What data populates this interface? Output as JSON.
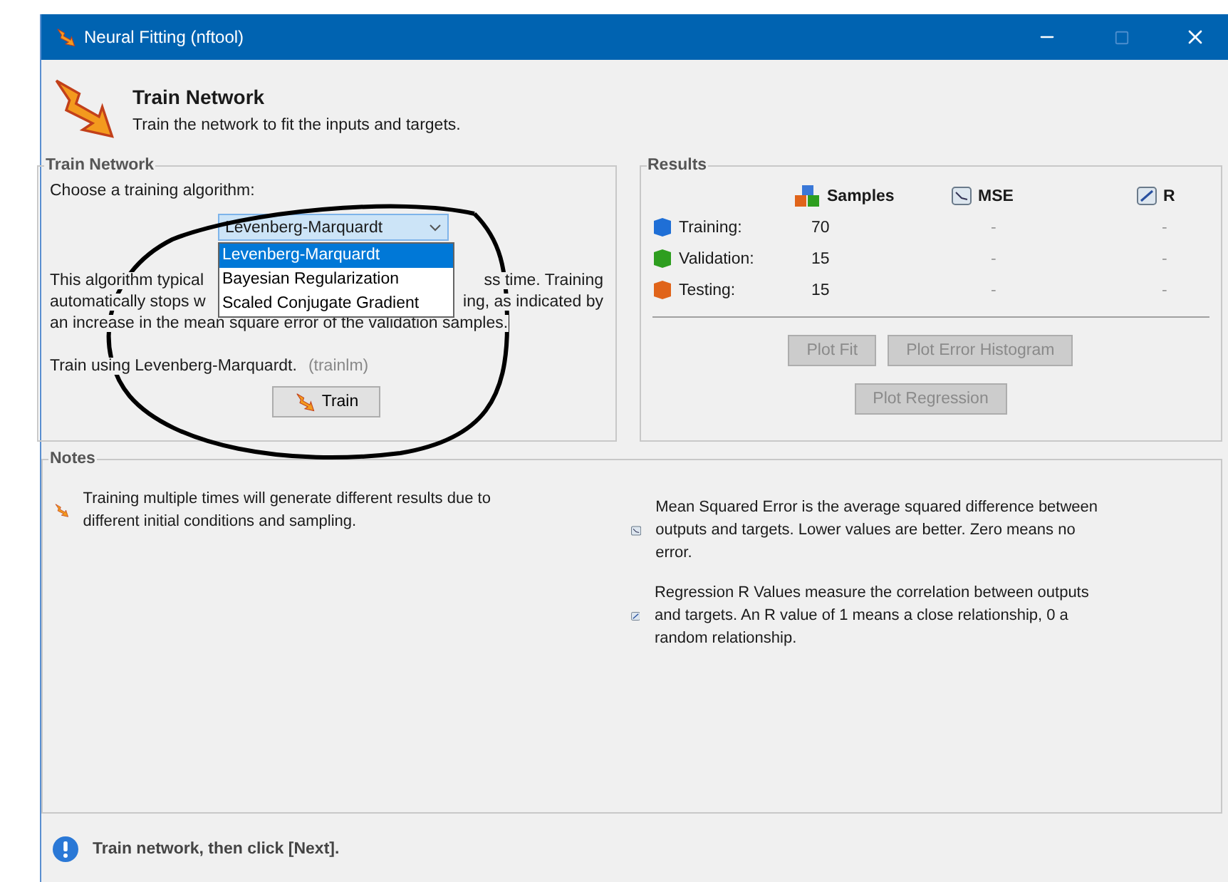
{
  "window": {
    "title": "Neural Fitting (nftool)"
  },
  "header": {
    "title": "Train Network",
    "subtitle": "Train the network to fit the inputs and targets."
  },
  "train_panel": {
    "title": "Train Network",
    "prompt": "Choose a training algorithm:",
    "algorithm": {
      "value": "Levenberg-Marquardt",
      "expanded": true,
      "options": [
        {
          "label": "Levenberg-Marquardt",
          "selected": true
        },
        {
          "label": "Bayesian Regularization",
          "selected": false
        },
        {
          "label": "Scaled Conjugate Gradient",
          "selected": false
        }
      ]
    },
    "description_lines": [
      {
        "left": "This algorithm typical",
        "right": "ss time. Training"
      },
      {
        "left": "automatically stops w",
        "right": "ing, as indicated by"
      },
      {
        "left": "an increase in the mean square error of the validation samples."
      }
    ],
    "train_using": "Train using Levenberg-Marquardt.",
    "function_name": "(trainlm)",
    "train_button": "Train"
  },
  "results": {
    "title": "Results",
    "columns": [
      {
        "label": "Samples",
        "kind": "samples"
      },
      {
        "label": "MSE",
        "kind": "mse"
      },
      {
        "label": "R",
        "kind": "regression"
      }
    ],
    "rows": [
      {
        "name": "Training:",
        "color": "#1f6fd6",
        "samples": "70",
        "mse": "-",
        "r": "-"
      },
      {
        "name": "Validation:",
        "color": "#2e9e1f",
        "samples": "15",
        "mse": "-",
        "r": "-"
      },
      {
        "name": "Testing:",
        "color": "#e0641a",
        "samples": "15",
        "mse": "-",
        "r": "-"
      }
    ],
    "buttons": [
      [
        {
          "label": "Plot Fit",
          "disabled": true
        },
        {
          "label": "Plot Error Histogram",
          "disabled": true
        }
      ],
      [
        {
          "label": "Plot Regression",
          "disabled": true
        }
      ]
    ]
  },
  "notes": {
    "title": "Notes",
    "items": [
      {
        "kind": "train",
        "text": "Training multiple times will generate different results due to different initial conditions and sampling."
      },
      {
        "kind": "mse",
        "text": "Mean Squared Error is the average squared difference between outputs and targets. Lower values are better. Zero means no error."
      },
      {
        "kind": "regression",
        "text": "Regression R Values measure the correlation between outputs and targets. An R value of 1 means a close relationship, 0 a random relationship."
      }
    ]
  },
  "status": {
    "text": "Train network, then click [Next]."
  }
}
